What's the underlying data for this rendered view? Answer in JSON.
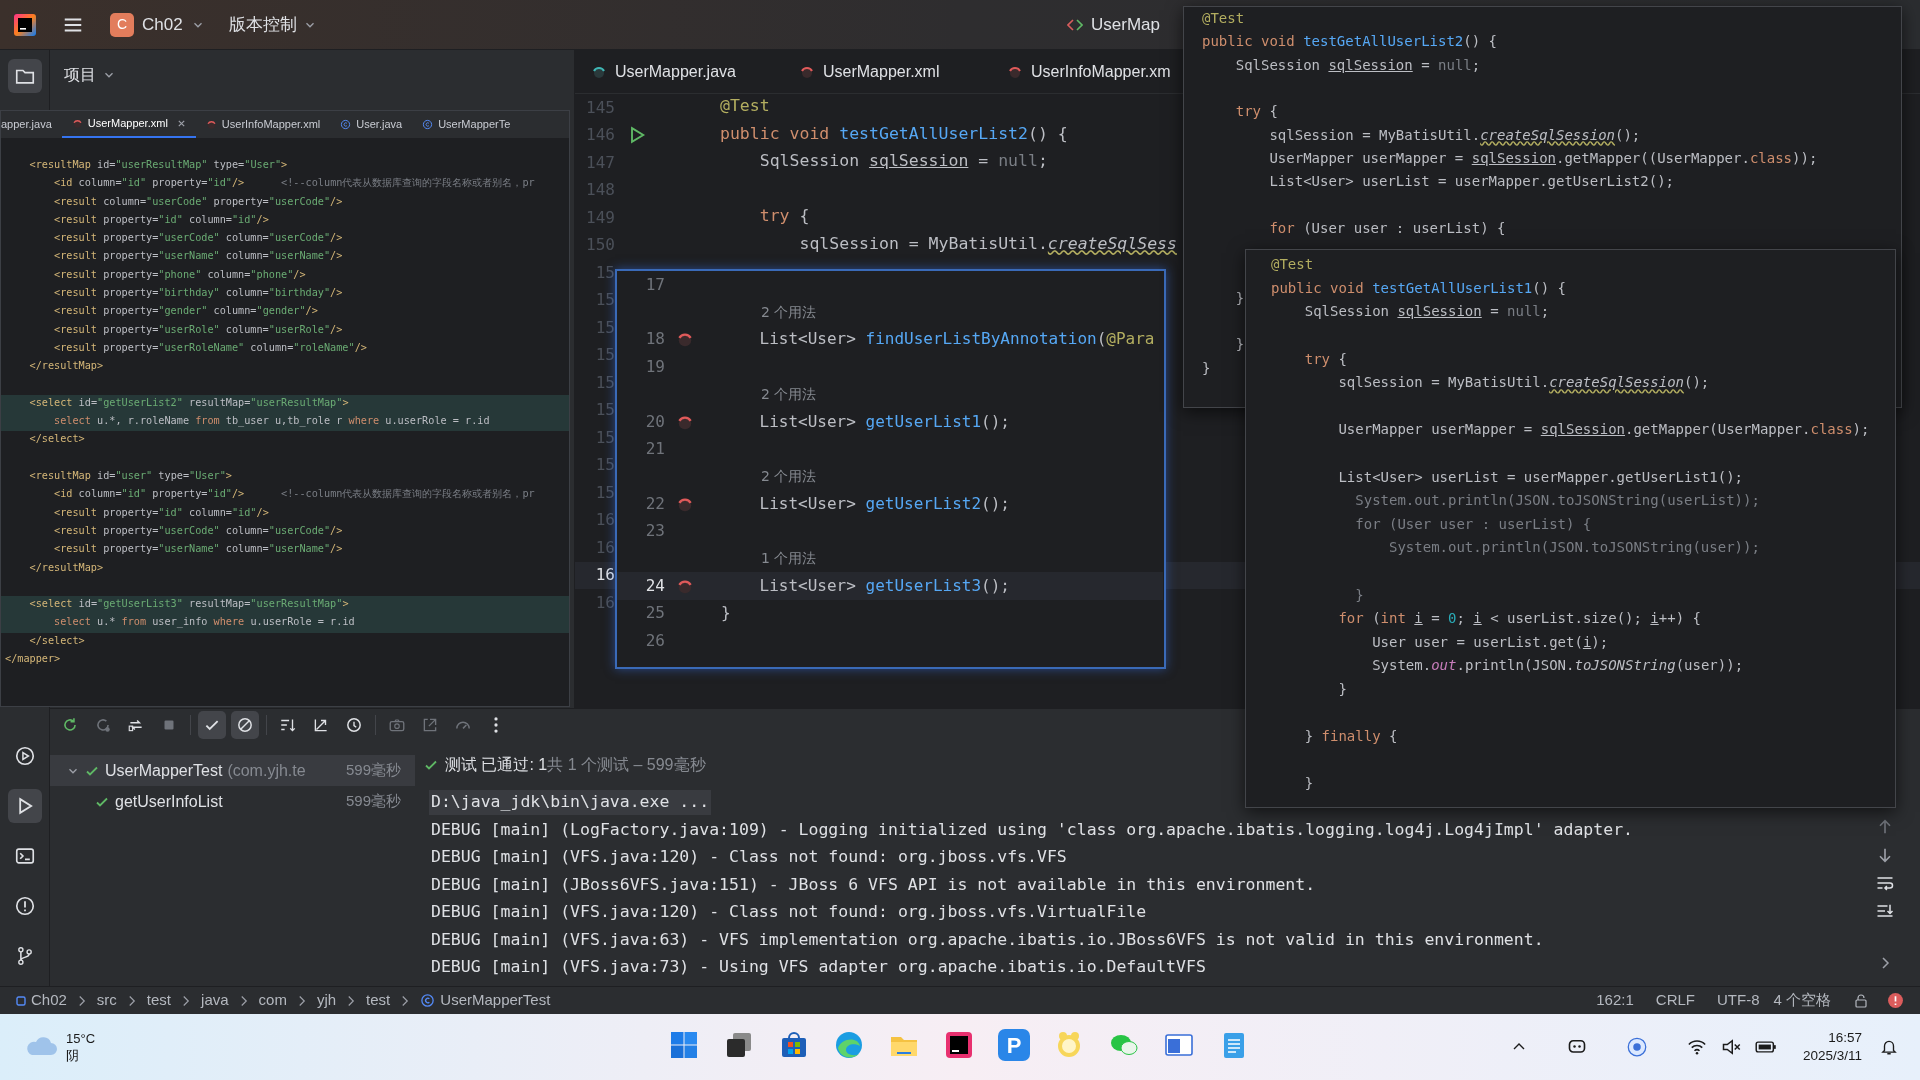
{
  "title_bar": {
    "project_badge": "C",
    "project": "Ch02",
    "vcs_menu": "版本控制",
    "run_config": "UserMap"
  },
  "tool_strip": {
    "top": [
      {
        "kind": "project",
        "selected": true
      }
    ],
    "bottom": [
      {
        "kind": "services",
        "selected": false
      },
      {
        "kind": "run",
        "selected": true
      },
      {
        "kind": "terminal",
        "selected": false
      },
      {
        "kind": "problems",
        "selected": false
      },
      {
        "kind": "git",
        "selected": false
      }
    ]
  },
  "project_panel": {
    "title": "项目"
  },
  "editor": {
    "tabs": [
      {
        "label": "UserMapper.java",
        "kind": "mapper-java",
        "selected": false
      },
      {
        "label": "UserMapper.xml",
        "kind": "mapper-xml",
        "selected": false
      },
      {
        "label": "UserInfoMapper.xm",
        "kind": "mapper-xml",
        "selected": false
      }
    ],
    "lines": [
      {
        "number": "145",
        "run_marker": false,
        "current": false,
        "code": [
          {
            "text": "@Test",
            "kind": "ann"
          }
        ]
      },
      {
        "number": "146",
        "run_marker": true,
        "current": false,
        "code": [
          {
            "text": "public void ",
            "kind": "kw"
          },
          {
            "text": "testGetAllUserList2",
            "kind": "decl"
          },
          {
            "text": "() {",
            "kind": "plain"
          }
        ]
      },
      {
        "number": "147",
        "run_marker": false,
        "current": false,
        "code": [
          {
            "text": "    SqlSession ",
            "kind": "plain"
          },
          {
            "text": "sqlSession",
            "kind": "var"
          },
          {
            "text": " = ",
            "kind": "plain"
          },
          {
            "text": "null",
            "kind": "muted"
          },
          {
            "text": ";",
            "kind": "plain"
          }
        ]
      },
      {
        "number": "148",
        "run_marker": false,
        "current": false
      },
      {
        "number": "149",
        "run_marker": false,
        "current": false,
        "code": [
          {
            "text": "    try ",
            "kind": "kw"
          },
          {
            "text": "{",
            "kind": "plain"
          }
        ]
      },
      {
        "number": "150",
        "run_marker": false,
        "current": false,
        "code": [
          {
            "text": "        sqlSession = MyBatisUtil.",
            "kind": "plain"
          },
          {
            "text": "createSqlSess",
            "kind": "warn"
          }
        ]
      },
      {
        "number": "15",
        "run_marker": false,
        "current": false
      },
      {
        "number": "15",
        "run_marker": false,
        "current": false
      },
      {
        "number": "15",
        "run_marker": false,
        "current": false
      },
      {
        "number": "15",
        "run_marker": false,
        "current": false
      },
      {
        "number": "15",
        "run_marker": false,
        "current": false
      },
      {
        "number": "15",
        "run_marker": false,
        "current": false
      },
      {
        "number": "15",
        "run_marker": false,
        "current": false
      },
      {
        "number": "15",
        "run_marker": false,
        "current": false
      },
      {
        "number": "15",
        "run_marker": false,
        "current": false
      },
      {
        "number": "16",
        "run_marker": false,
        "current": false
      },
      {
        "number": "16",
        "run_marker": false,
        "current": false
      },
      {
        "number": "16",
        "run_marker": false,
        "current": true
      },
      {
        "number": "16",
        "run_marker": false,
        "current": false
      }
    ]
  },
  "xml_window": {
    "tabs": [
      {
        "label": "apper.java",
        "kind": "plain",
        "selected": false
      },
      {
        "label": "UserMapper.xml",
        "kind": "mapper-xml",
        "selected": true
      },
      {
        "label": "UserInfoMapper.xml",
        "kind": "mapper-xml",
        "selected": false
      },
      {
        "label": "User.java",
        "kind": "class",
        "selected": false
      },
      {
        "label": "UserMapperTe",
        "kind": "class",
        "selected": false
      }
    ],
    "lines": [
      {
        "highlighted": false,
        "code": [
          {
            "text": "    <resultMap ",
            "kind": "tag"
          },
          {
            "text": "id=",
            "kind": "plain"
          },
          {
            "text": "\"userResultMap\"",
            "kind": "str"
          },
          {
            "text": " type=",
            "kind": "plain"
          },
          {
            "text": "\"User\"",
            "kind": "str"
          },
          {
            "text": ">",
            "kind": "tag"
          }
        ]
      },
      {
        "highlighted": false,
        "code": [
          {
            "text": "        <id ",
            "kind": "tag"
          },
          {
            "text": "column=",
            "kind": "plain"
          },
          {
            "text": "\"id\"",
            "kind": "str"
          },
          {
            "text": " property=",
            "kind": "plain"
          },
          {
            "text": "\"id\"",
            "kind": "str"
          },
          {
            "text": "/>",
            "kind": "tag"
          },
          {
            "text": "      <!--column代表从数据库查询的字段名称或者别名，pr",
            "kind": "muted"
          }
        ]
      },
      {
        "highlighted": false,
        "code": [
          {
            "text": "        <result ",
            "kind": "tag"
          },
          {
            "text": "column=",
            "kind": "plain"
          },
          {
            "text": "\"userCode\"",
            "kind": "str"
          },
          {
            "text": " property=",
            "kind": "plain"
          },
          {
            "text": "\"userCode\"",
            "kind": "str"
          },
          {
            "text": "/>",
            "kind": "tag"
          }
        ]
      },
      {
        "highlighted": false,
        "code": [
          {
            "text": "        <result ",
            "kind": "tag"
          },
          {
            "text": "property=",
            "kind": "plain"
          },
          {
            "text": "\"id\"",
            "kind": "str"
          },
          {
            "text": " column=",
            "kind": "plain"
          },
          {
            "text": "\"id\"",
            "kind": "str"
          },
          {
            "text": "/>",
            "kind": "tag"
          }
        ]
      },
      {
        "highlighted": false,
        "code": [
          {
            "text": "        <result ",
            "kind": "tag"
          },
          {
            "text": "property=",
            "kind": "plain"
          },
          {
            "text": "\"userCode\"",
            "kind": "str"
          },
          {
            "text": " column=",
            "kind": "plain"
          },
          {
            "text": "\"userCode\"",
            "kind": "str"
          },
          {
            "text": "/>",
            "kind": "tag"
          }
        ]
      },
      {
        "highlighted": false,
        "code": [
          {
            "text": "        <result ",
            "kind": "tag"
          },
          {
            "text": "property=",
            "kind": "plain"
          },
          {
            "text": "\"userName\"",
            "kind": "str"
          },
          {
            "text": " column=",
            "kind": "plain"
          },
          {
            "text": "\"userName\"",
            "kind": "str"
          },
          {
            "text": "/>",
            "kind": "tag"
          }
        ]
      },
      {
        "highlighted": false,
        "code": [
          {
            "text": "        <result ",
            "kind": "tag"
          },
          {
            "text": "property=",
            "kind": "plain"
          },
          {
            "text": "\"phone\"",
            "kind": "str"
          },
          {
            "text": " column=",
            "kind": "plain"
          },
          {
            "text": "\"phone\"",
            "kind": "str"
          },
          {
            "text": "/>",
            "kind": "tag"
          }
        ]
      },
      {
        "highlighted": false,
        "code": [
          {
            "text": "        <result ",
            "kind": "tag"
          },
          {
            "text": "property=",
            "kind": "plain"
          },
          {
            "text": "\"birthday\"",
            "kind": "str"
          },
          {
            "text": " column=",
            "kind": "plain"
          },
          {
            "text": "\"birthday\"",
            "kind": "str"
          },
          {
            "text": "/>",
            "kind": "tag"
          }
        ]
      },
      {
        "highlighted": false,
        "code": [
          {
            "text": "        <result ",
            "kind": "tag"
          },
          {
            "text": "property=",
            "kind": "plain"
          },
          {
            "text": "\"gender\"",
            "kind": "str"
          },
          {
            "text": " column=",
            "kind": "plain"
          },
          {
            "text": "\"gender\"",
            "kind": "str"
          },
          {
            "text": "/>",
            "kind": "tag"
          }
        ]
      },
      {
        "highlighted": false,
        "code": [
          {
            "text": "        <result ",
            "kind": "tag"
          },
          {
            "text": "property=",
            "kind": "plain"
          },
          {
            "text": "\"userRole\"",
            "kind": "str"
          },
          {
            "text": " column=",
            "kind": "plain"
          },
          {
            "text": "\"userRole\"",
            "kind": "str"
          },
          {
            "text": "/>",
            "kind": "tag"
          }
        ]
      },
      {
        "highlighted": false,
        "code": [
          {
            "text": "        <result ",
            "kind": "tag"
          },
          {
            "text": "property=",
            "kind": "plain"
          },
          {
            "text": "\"userRoleName\"",
            "kind": "str"
          },
          {
            "text": " column=",
            "kind": "plain"
          },
          {
            "text": "\"roleName\"",
            "kind": "str"
          },
          {
            "text": "/>",
            "kind": "tag"
          }
        ]
      },
      {
        "highlighted": false,
        "code": [
          {
            "text": "    </resultMap>",
            "kind": "tag"
          }
        ]
      },
      {
        "highlighted": false
      },
      {
        "highlighted": true,
        "code": [
          {
            "text": "    <select ",
            "kind": "tag"
          },
          {
            "text": "id=",
            "kind": "plain"
          },
          {
            "text": "\"getUserList2\"",
            "kind": "str"
          },
          {
            "text": " resultMap=",
            "kind": "plain"
          },
          {
            "text": "\"userResultMap\"",
            "kind": "str"
          },
          {
            "text": ">",
            "kind": "tag"
          }
        ]
      },
      {
        "highlighted": true,
        "code": [
          {
            "text": "        select ",
            "kind": "kw"
          },
          {
            "text": "u.*, r.roleName ",
            "kind": "plain"
          },
          {
            "text": "from ",
            "kind": "kw"
          },
          {
            "text": "tb_user u,tb_role r ",
            "kind": "plain"
          },
          {
            "text": "where ",
            "kind": "kw"
          },
          {
            "text": "u.userRole = r.id",
            "kind": "plain"
          }
        ]
      },
      {
        "highlighted": false,
        "code": [
          {
            "text": "    </select>",
            "kind": "tag"
          }
        ]
      },
      {
        "highlighted": false
      },
      {
        "highlighted": false,
        "code": [
          {
            "text": "    <resultMap ",
            "kind": "tag"
          },
          {
            "text": "id=",
            "kind": "plain"
          },
          {
            "text": "\"user\"",
            "kind": "str"
          },
          {
            "text": " type=",
            "kind": "plain"
          },
          {
            "text": "\"User\"",
            "kind": "str"
          },
          {
            "text": ">",
            "kind": "tag"
          }
        ]
      },
      {
        "highlighted": false,
        "code": [
          {
            "text": "        <id ",
            "kind": "tag"
          },
          {
            "text": "column=",
            "kind": "plain"
          },
          {
            "text": "\"id\"",
            "kind": "str"
          },
          {
            "text": " property=",
            "kind": "plain"
          },
          {
            "text": "\"id\"",
            "kind": "str"
          },
          {
            "text": "/>",
            "kind": "tag"
          },
          {
            "text": "      <!--column代表从数据库查询的字段名称或者别名，pr",
            "kind": "muted"
          }
        ]
      },
      {
        "highlighted": false,
        "code": [
          {
            "text": "        <result ",
            "kind": "tag"
          },
          {
            "text": "property=",
            "kind": "plain"
          },
          {
            "text": "\"id\"",
            "kind": "str"
          },
          {
            "text": " column=",
            "kind": "plain"
          },
          {
            "text": "\"id\"",
            "kind": "str"
          },
          {
            "text": "/>",
            "kind": "tag"
          }
        ]
      },
      {
        "highlighted": false,
        "code": [
          {
            "text": "        <result ",
            "kind": "tag"
          },
          {
            "text": "property=",
            "kind": "plain"
          },
          {
            "text": "\"userCode\"",
            "kind": "str"
          },
          {
            "text": " column=",
            "kind": "plain"
          },
          {
            "text": "\"userCode\"",
            "kind": "str"
          },
          {
            "text": "/>",
            "kind": "tag"
          }
        ]
      },
      {
        "highlighted": false,
        "code": [
          {
            "text": "        <result ",
            "kind": "tag"
          },
          {
            "text": "property=",
            "kind": "plain"
          },
          {
            "text": "\"userName\"",
            "kind": "str"
          },
          {
            "text": " column=",
            "kind": "plain"
          },
          {
            "text": "\"userName\"",
            "kind": "str"
          },
          {
            "text": "/>",
            "kind": "tag"
          }
        ]
      },
      {
        "highlighted": false,
        "code": [
          {
            "text": "    </resultMap>",
            "kind": "tag"
          }
        ]
      },
      {
        "highlighted": false
      },
      {
        "highlighted": true,
        "code": [
          {
            "text": "    <select ",
            "kind": "tag"
          },
          {
            "text": "id=",
            "kind": "plain"
          },
          {
            "text": "\"getUserList3\"",
            "kind": "str"
          },
          {
            "text": " resultMap=",
            "kind": "plain"
          },
          {
            "text": "\"userResultMap\"",
            "kind": "str"
          },
          {
            "text": ">",
            "kind": "tag"
          }
        ]
      },
      {
        "highlighted": true,
        "code": [
          {
            "text": "        select ",
            "kind": "kw"
          },
          {
            "text": "u.* ",
            "kind": "plain"
          },
          {
            "text": "from ",
            "kind": "kw"
          },
          {
            "text": "user_info ",
            "kind": "plain"
          },
          {
            "text": "where ",
            "kind": "kw"
          },
          {
            "text": "u.userRole = r.id",
            "kind": "plain"
          }
        ]
      },
      {
        "highlighted": false,
        "code": [
          {
            "text": "    </select>",
            "kind": "tag"
          }
        ]
      },
      {
        "highlighted": false,
        "code": [
          {
            "text": "</mapper>",
            "kind": "tag"
          }
        ]
      }
    ]
  },
  "usages_popup": {
    "rows": [
      {
        "kind": "code",
        "number": "17",
        "mapper_icon": false,
        "current": false
      },
      {
        "kind": "hint",
        "text": "2 个用法"
      },
      {
        "kind": "code",
        "number": "18",
        "mapper_icon": true,
        "current": false,
        "code": [
          {
            "text": "    List<User> ",
            "kind": "plain"
          },
          {
            "text": "findUserListByAnnotation",
            "kind": "decl"
          },
          {
            "text": "(",
            "kind": "plain"
          },
          {
            "text": "@Para",
            "kind": "ann"
          }
        ]
      },
      {
        "kind": "code",
        "number": "19",
        "mapper_icon": false,
        "current": false
      },
      {
        "kind": "hint",
        "text": "2 个用法"
      },
      {
        "kind": "code",
        "number": "20",
        "mapper_icon": true,
        "current": false,
        "code": [
          {
            "text": "    List<User> ",
            "kind": "plain"
          },
          {
            "text": "getUserList1",
            "kind": "decl"
          },
          {
            "text": "();",
            "kind": "plain"
          }
        ]
      },
      {
        "kind": "code",
        "number": "21",
        "mapper_icon": false,
        "current": false
      },
      {
        "kind": "hint",
        "text": "2 个用法"
      },
      {
        "kind": "code",
        "number": "22",
        "mapper_icon": true,
        "current": false,
        "code": [
          {
            "text": "    List<User> ",
            "kind": "plain"
          },
          {
            "text": "getUserList2",
            "kind": "decl"
          },
          {
            "text": "();",
            "kind": "plain"
          }
        ]
      },
      {
        "kind": "code",
        "number": "23",
        "mapper_icon": false,
        "current": false
      },
      {
        "kind": "hint",
        "text": "1 个用法"
      },
      {
        "kind": "code",
        "number": "24",
        "mapper_icon": true,
        "current": true,
        "code": [
          {
            "text": "    List<User> ",
            "kind": "plain"
          },
          {
            "text": "getUserList3",
            "kind": "decl"
          },
          {
            "text": "();",
            "kind": "plain"
          }
        ]
      },
      {
        "kind": "code",
        "number": "25",
        "mapper_icon": false,
        "current": false,
        "code": [
          {
            "text": "}",
            "kind": "plain"
          }
        ]
      },
      {
        "kind": "code",
        "number": "26",
        "mapper_icon": false,
        "current": false
      }
    ]
  },
  "snippet_window_1": {
    "lines": [
      {
        "kind": "code",
        "code": [
          {
            "text": "@Test",
            "kind": "ann"
          }
        ]
      },
      {
        "kind": "code",
        "code": [
          {
            "text": "public void ",
            "kind": "kw"
          },
          {
            "text": "testGetAllUserList2",
            "kind": "decl"
          },
          {
            "text": "() {",
            "kind": "plain"
          }
        ]
      },
      {
        "kind": "code",
        "code": [
          {
            "text": "    SqlSession ",
            "kind": "plain"
          },
          {
            "text": "sqlSession",
            "kind": "var"
          },
          {
            "text": " = ",
            "kind": "plain"
          },
          {
            "text": "null",
            "kind": "muted"
          },
          {
            "text": ";",
            "kind": "plain"
          }
        ]
      },
      {
        "kind": "blank"
      },
      {
        "kind": "code",
        "code": [
          {
            "text": "    try ",
            "kind": "kw"
          },
          {
            "text": "{",
            "kind": "plain"
          }
        ]
      },
      {
        "kind": "code",
        "code": [
          {
            "text": "        sqlSession = MyBatisUtil.",
            "kind": "plain"
          },
          {
            "text": "createSqlSession",
            "kind": "warn"
          },
          {
            "text": "();",
            "kind": "plain"
          }
        ]
      },
      {
        "kind": "code",
        "code": [
          {
            "text": "        UserMapper userMapper = ",
            "kind": "plain"
          },
          {
            "text": "sqlSession",
            "kind": "var"
          },
          {
            "text": ".getMapper((UserMapper.",
            "kind": "plain"
          },
          {
            "text": "class",
            "kind": "kw"
          },
          {
            "text": "));",
            "kind": "plain"
          }
        ]
      },
      {
        "kind": "code",
        "code": [
          {
            "text": "        List<User> userList = userMapper.getUserList2();",
            "kind": "plain"
          }
        ]
      },
      {
        "kind": "blank"
      },
      {
        "kind": "code",
        "code": [
          {
            "text": "        for ",
            "kind": "kw"
          },
          {
            "text": "(User user : userList) {",
            "kind": "plain"
          }
        ]
      },
      {
        "kind": "blank"
      },
      {
        "kind": "blank"
      },
      {
        "kind": "code",
        "code": [
          {
            "text": "    }",
            "kind": "plain"
          }
        ]
      },
      {
        "kind": "blank"
      },
      {
        "kind": "code",
        "code": [
          {
            "text": "    }",
            "kind": "plain"
          }
        ]
      },
      {
        "kind": "code",
        "code": [
          {
            "text": "}",
            "kind": "plain"
          }
        ]
      }
    ]
  },
  "snippet_window_2": {
    "lines": [
      {
        "kind": "code",
        "code": [
          {
            "text": "@Test",
            "kind": "ann"
          }
        ]
      },
      {
        "kind": "code",
        "code": [
          {
            "text": "public void ",
            "kind": "kw"
          },
          {
            "text": "testGetAllUserList1",
            "kind": "decl"
          },
          {
            "text": "() {",
            "kind": "plain"
          }
        ]
      },
      {
        "kind": "code",
        "code": [
          {
            "text": "    SqlSession ",
            "kind": "plain"
          },
          {
            "text": "sqlSession",
            "kind": "var"
          },
          {
            "text": " = ",
            "kind": "plain"
          },
          {
            "text": "null",
            "kind": "muted"
          },
          {
            "text": ";",
            "kind": "plain"
          }
        ]
      },
      {
        "kind": "blank"
      },
      {
        "kind": "code",
        "code": [
          {
            "text": "    try ",
            "kind": "kw"
          },
          {
            "text": "{",
            "kind": "plain"
          }
        ]
      },
      {
        "kind": "code",
        "code": [
          {
            "text": "        sqlSession = MyBatisUtil.",
            "kind": "plain"
          },
          {
            "text": "createSqlSession",
            "kind": "warn"
          },
          {
            "text": "();",
            "kind": "plain"
          }
        ]
      },
      {
        "kind": "blank"
      },
      {
        "kind": "code",
        "code": [
          {
            "text": "        UserMapper userMapper = ",
            "kind": "plain"
          },
          {
            "text": "sqlSession",
            "kind": "var"
          },
          {
            "text": ".getMapper(UserMapper.",
            "kind": "plain"
          },
          {
            "text": "class",
            "kind": "kw"
          },
          {
            "text": ");",
            "kind": "plain"
          }
        ]
      },
      {
        "kind": "blank"
      },
      {
        "kind": "code",
        "code": [
          {
            "text": "        List<User> userList = userMapper.getUserList1();",
            "kind": "plain"
          }
        ]
      },
      {
        "kind": "code",
        "code": [
          {
            "text": "          System.out.println(JSON.toJSONString(userList));",
            "kind": "muted"
          }
        ]
      },
      {
        "kind": "code",
        "code": [
          {
            "text": "          for (User user : userList) {",
            "kind": "muted"
          }
        ]
      },
      {
        "kind": "code",
        "code": [
          {
            "text": "              System.out.println(JSON.toJSONString(user));",
            "kind": "muted"
          }
        ]
      },
      {
        "kind": "blank"
      },
      {
        "kind": "code",
        "code": [
          {
            "text": "          }",
            "kind": "muted"
          }
        ]
      },
      {
        "kind": "code",
        "code": [
          {
            "text": "        for",
            "kind": "kw"
          },
          {
            "text": " (",
            "kind": "plain"
          },
          {
            "text": "int ",
            "kind": "kw"
          },
          {
            "text": "i",
            "kind": "var"
          },
          {
            "text": " = ",
            "kind": "plain"
          },
          {
            "text": "0",
            "kind": "num"
          },
          {
            "text": "; ",
            "kind": "plain"
          },
          {
            "text": "i",
            "kind": "var"
          },
          {
            "text": " < userList.size(); ",
            "kind": "plain"
          },
          {
            "text": "i",
            "kind": "var"
          },
          {
            "text": "++) {",
            "kind": "plain"
          }
        ]
      },
      {
        "kind": "code",
        "code": [
          {
            "text": "            User user = userList.get(",
            "kind": "plain"
          },
          {
            "text": "i",
            "kind": "var"
          },
          {
            "text": ");",
            "kind": "plain"
          }
        ]
      },
      {
        "kind": "code",
        "code": [
          {
            "text": "            System.",
            "kind": "plain"
          },
          {
            "text": "out",
            "kind": "field"
          },
          {
            "text": ".println(JSON.",
            "kind": "plain"
          },
          {
            "text": "toJSONString",
            "kind": "ital"
          },
          {
            "text": "(user));",
            "kind": "plain"
          }
        ]
      },
      {
        "kind": "code",
        "code": [
          {
            "text": "        }",
            "kind": "plain"
          }
        ]
      },
      {
        "kind": "blank"
      },
      {
        "kind": "code",
        "code": [
          {
            "text": "    } ",
            "kind": "plain"
          },
          {
            "text": "finally ",
            "kind": "kw"
          },
          {
            "text": "{",
            "kind": "plain"
          }
        ]
      },
      {
        "kind": "blank"
      },
      {
        "kind": "code",
        "code": [
          {
            "text": "    }",
            "kind": "plain"
          }
        ]
      }
    ]
  },
  "run_panel": {
    "toolbar": [
      {
        "kind": "rerun",
        "selected": false
      },
      {
        "kind": "rerun-failed",
        "selected": false
      },
      {
        "kind": "auto-test",
        "selected": false
      },
      {
        "kind": "stop",
        "selected": false
      },
      {
        "kind": "show-passed",
        "selected": true
      },
      {
        "kind": "show-ignored",
        "selected": true
      },
      {
        "kind": "sort-alpha",
        "selected": false
      },
      {
        "kind": "sort-duration",
        "selected": false
      },
      {
        "kind": "history",
        "selected": false
      },
      {
        "kind": "camera",
        "selected": false
      },
      {
        "kind": "import",
        "selected": false
      },
      {
        "kind": "gauge",
        "selected": false
      },
      {
        "kind": "more",
        "selected": false
      }
    ],
    "tree": [
      {
        "label": "UserMapperTest",
        "package": "(com.yjh.te",
        "time": "599毫秒",
        "selected": true,
        "expanded": true,
        "children": [
          {
            "label": "getUserInfoList",
            "time": "599毫秒",
            "selected": false
          }
        ]
      }
    ],
    "summary": {
      "result": "测试 已通过: 1",
      "detail": "共 1 个测试 – 599毫秒"
    },
    "console": [
      {
        "text": "D:\\java_jdk\\bin\\java.exe ...",
        "highlighted": true
      },
      {
        "text": "DEBUG [main] (LogFactory.java:109) - Logging initialized using 'class org.apache.ibatis.logging.log4j.Log4jImpl' adapter.",
        "highlighted": false
      },
      {
        "text": "DEBUG [main] (VFS.java:120) - Class not found: org.jboss.vfs.VFS",
        "highlighted": false
      },
      {
        "text": "DEBUG [main] (JBoss6VFS.java:151) - JBoss 6 VFS API is not available in this environment.",
        "highlighted": false
      },
      {
        "text": "DEBUG [main] (VFS.java:120) - Class not found: org.jboss.vfs.VirtualFile",
        "highlighted": false
      },
      {
        "text": "DEBUG [main] (VFS.java:63) - VFS implementation org.apache.ibatis.io.JBoss6VFS is not valid in this environment.",
        "highlighted": false
      },
      {
        "text": "DEBUG [main] (VFS.java:73) - Using VFS adapter org.apache.ibatis.io.DefaultVFS",
        "highlighted": false
      }
    ]
  },
  "status_bar": {
    "breadcrumbs": [
      {
        "label": "Ch02",
        "kind": "module"
      },
      {
        "label": "src",
        "kind": "plain"
      },
      {
        "label": "test",
        "kind": "plain"
      },
      {
        "label": "java",
        "kind": "plain"
      },
      {
        "label": "com",
        "kind": "plain"
      },
      {
        "label": "yjh",
        "kind": "plain"
      },
      {
        "label": "test",
        "kind": "plain"
      },
      {
        "label": "UserMapperTest",
        "kind": "class"
      }
    ],
    "position": "162:1",
    "line_ending": "CRLF",
    "encoding": "UTF-8",
    "indent": "4 个空格"
  },
  "taskbar": {
    "weather": {
      "temperature": "15°C",
      "condition": "阴"
    },
    "apps": [
      {
        "kind": "start"
      },
      {
        "kind": "task-view"
      },
      {
        "kind": "store"
      },
      {
        "kind": "browser"
      },
      {
        "kind": "files"
      },
      {
        "kind": "ide"
      },
      {
        "kind": "letter",
        "label": "P"
      },
      {
        "kind": "pet"
      },
      {
        "kind": "chat"
      },
      {
        "kind": "window"
      },
      {
        "kind": "notepad"
      }
    ],
    "clock": {
      "time": "16:57",
      "date": "2025/3/11"
    }
  }
}
